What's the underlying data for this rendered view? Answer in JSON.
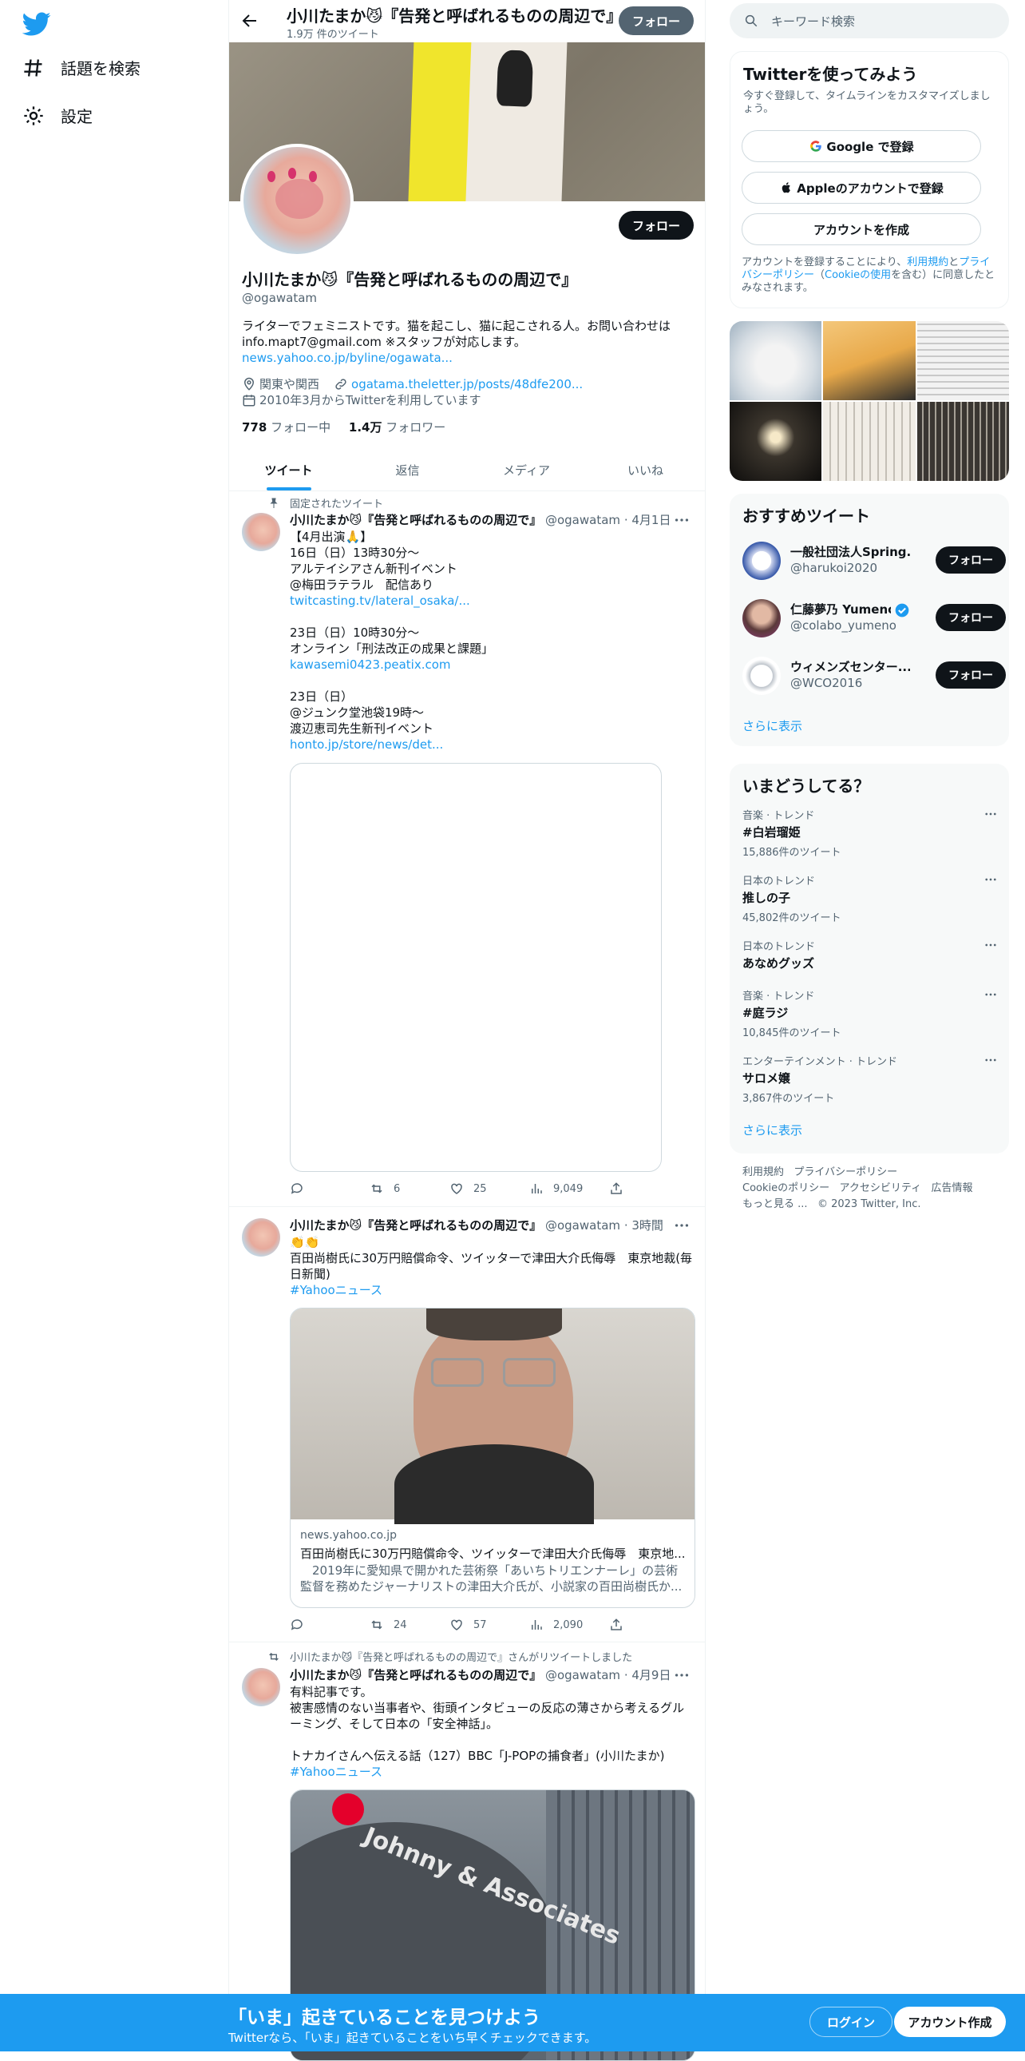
{
  "nav": {
    "explore": "話題を検索",
    "settings": "設定"
  },
  "header": {
    "title": "小川たまか😼『告発と呼ばれるものの周辺で』",
    "tweet_count": "1.9万 件のツイート",
    "follow": "フォロー"
  },
  "profile": {
    "name": "小川たまか😼『告発と呼ばれるものの周辺で』",
    "handle": "@ogawatam",
    "follow": "フォロー",
    "bio_text": "ライターでフェミニストです。猫を起こし、猫に起こされる人。お問い合わせは info.mapt7@gmail.com ※スタッフが対応します。",
    "bio_link": "news.yahoo.co.jp/byline/ogawata...",
    "location": "関東や関西",
    "website": "ogatama.theletter.jp/posts/48dfe200...",
    "joined": "2010年3月からTwitterを利用しています",
    "following_count": "778",
    "following_label": "フォロー中",
    "followers_count": "1.4万",
    "followers_label": "フォロワー"
  },
  "tabs": [
    "ツイート",
    "返信",
    "メディア",
    "いいね"
  ],
  "tweets": [
    {
      "context": "固定されたツイート",
      "name": "小川たまか😼『告発と呼ばれるものの周辺で』",
      "handle": "@ogawatam",
      "time": "4月1日",
      "body1": "【4月出演🙏】\n16日（日）13時30分〜\nアルテイシアさん新刊イベント\n@梅田ラテラル　配信あり",
      "link1": "twitcasting.tv/lateral_osaka/...",
      "body2": "23日（日）10時30分〜\nオンライン「刑法改正の成果と課題」",
      "link2": "kawasemi0423.peatix.com",
      "body3": "23日（日）\n@ジュンク堂池袋19時〜\n渡辺恵司先生新刊イベント",
      "link3": "honto.jp/store/news/det...",
      "replies": "",
      "retweets": "6",
      "likes": "25",
      "views": "9,049"
    },
    {
      "name": "小川たまか😼『告発と呼ばれるものの周辺で』",
      "handle": "@ogawatam",
      "time": "3時間",
      "body": "👏👏\n百田尚樹氏に30万円賠償命令、ツイッターで津田大介氏侮辱　東京地裁(毎日新聞)",
      "hashtag": "#Yahooニュース",
      "card_domain": "news.yahoo.co.jp",
      "card_title": "百田尚樹氏に30万円賠償命令、ツイッターで津田大介氏侮辱　東京地...",
      "card_desc": "　2019年に愛知県で開かれた芸術祭「あいちトリエンナーレ」の芸術監督を務めたジャーナリストの津田大介氏が、小説家の百田尚樹氏か...",
      "replies": "",
      "retweets": "24",
      "likes": "57",
      "views": "2,090"
    },
    {
      "context": "小川たまか😼『告発と呼ばれるものの周辺で』さんがリツイートしました",
      "name": "小川たまか😼『告発と呼ばれるものの周辺で』",
      "handle": "@ogawatam",
      "time": "4月9日",
      "body": "有料記事です。\n被害感情のない当事者や、街頭インタビューの反応の薄さから考えるグルーミング、そして日本の「安全神話」。\n\nトナカイさんへ伝える話（127）BBC「J-POPの捕食者」(小川たまか)",
      "hashtag": "#Yahooニュース",
      "image_sign": "Johnny & Associates"
    }
  ],
  "right": {
    "search_placeholder": "キーワード検索",
    "signup_title": "Twitterを使ってみよう",
    "signup_sub": "今すぐ登録して、タイムラインをカスタマイズしましょう。",
    "google": "Google で登録",
    "apple": "Appleのアカウントで登録",
    "create": "アカウントを作成",
    "terms_pre": "アカウントを登録することにより、",
    "terms_link1": "利用規約",
    "terms_mid": "と",
    "terms_link2": "プライバシーポリシー",
    "terms_open": "（",
    "terms_link3": "Cookieの使用",
    "terms_end": "を含む）に同意したとみなされます。",
    "rec_title": "おすすめツイート",
    "recs": [
      {
        "name": "一般社団法人Spring...",
        "handle": "@harukoi2020",
        "follow": "フォロー"
      },
      {
        "name": "仁藤夢乃 Yumeno...",
        "handle": "@colabo_yumeno",
        "follow": "フォロー"
      },
      {
        "name": "ウィメンズセンター...",
        "handle": "@WCO2016",
        "follow": "フォロー"
      }
    ],
    "show_more": "さらに表示",
    "trends_title": "いまどうしてる？",
    "trends": [
      {
        "cat": "音楽 · トレンド",
        "name": "#白岩瑠姫",
        "count": "15,886件のツイート"
      },
      {
        "cat": "日本のトレンド",
        "name": "推しの子",
        "count": "45,802件のツイート"
      },
      {
        "cat": "日本のトレンド",
        "name": "あなめグッズ",
        "count": ""
      },
      {
        "cat": "音楽 · トレンド",
        "name": "#庭ラジ",
        "count": "10,845件のツイート"
      },
      {
        "cat": "エンターテインメント · トレンド",
        "name": "サロメ嬢",
        "count": "3,867件のツイート"
      }
    ],
    "trends_more": "さらに表示",
    "footer": [
      "利用規約",
      "プライバシーポリシー",
      "Cookieのポリシー",
      "アクセシビリティ",
      "広告情報",
      "もっと見る ...",
      "© 2023 Twitter, Inc."
    ]
  },
  "bottom": {
    "title": "「いま」起きていることを見つけよう",
    "sub": "Twitterなら、「いま」起きていることをいち早くチェックできます。",
    "login": "ログイン",
    "signup": "アカウント作成"
  },
  "colors": {
    "accent": "#1d9bf0",
    "text": "#0f1419",
    "muted": "#536471",
    "banner_yellow": "#f2e631"
  }
}
